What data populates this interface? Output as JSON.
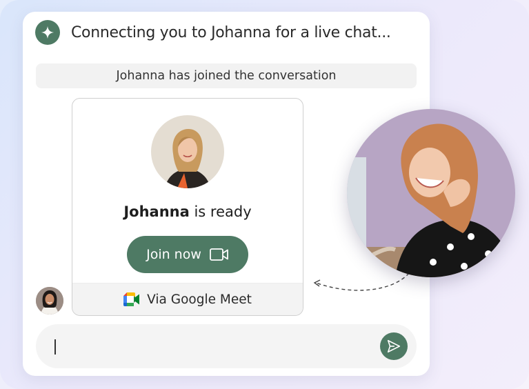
{
  "chat": {
    "header_text": "Connecting you to Johanna for a live chat...",
    "system_message": "Johanna has joined the conversation"
  },
  "invite": {
    "agent_name": "Johanna",
    "ready_suffix": " is ready",
    "join_label": "Join now",
    "via_label": "Via Google Meet"
  },
  "composer": {
    "value": ""
  },
  "colors": {
    "brand": "#4e7a64",
    "photo_bg": "#b7a5c4",
    "system_bg": "#f2f2f2"
  },
  "icons": [
    "sparkle-icon",
    "video-camera-icon",
    "google-meet-icon",
    "send-icon"
  ]
}
